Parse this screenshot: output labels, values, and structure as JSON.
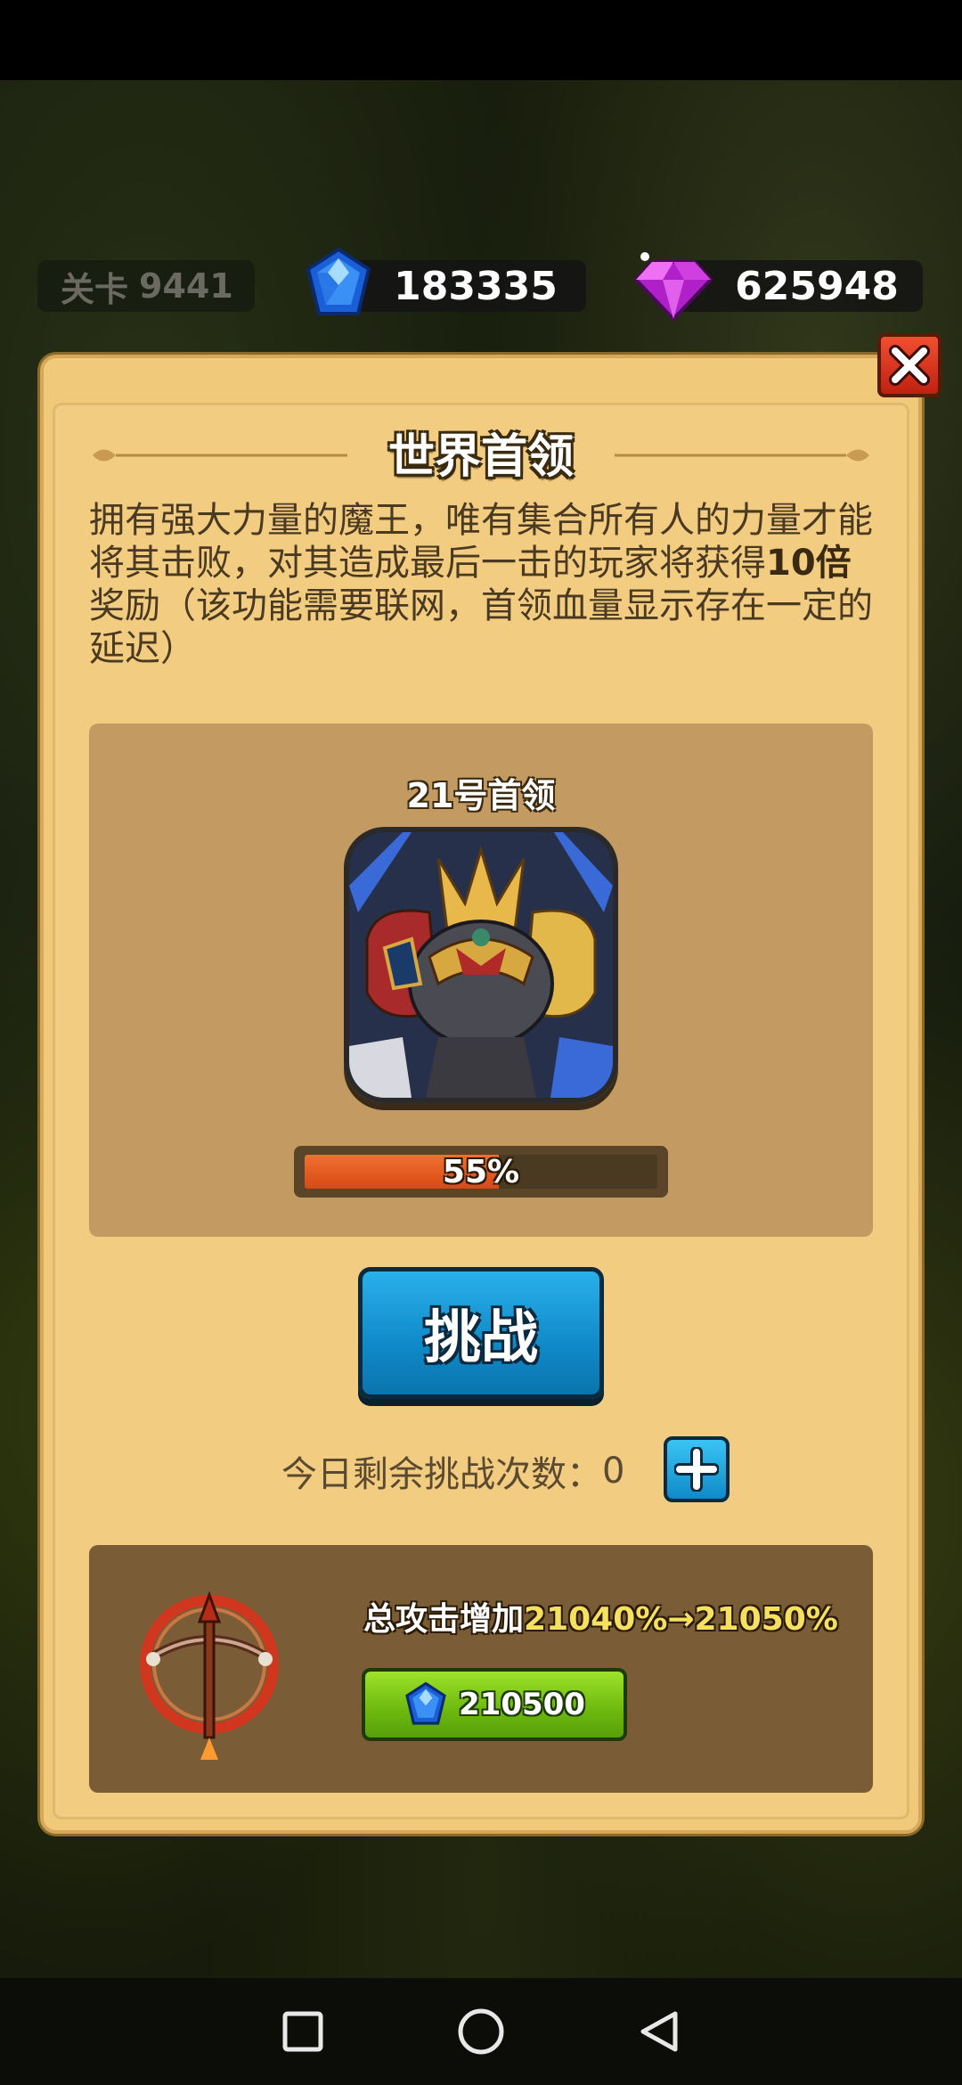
{
  "hud": {
    "level_label": "关卡",
    "level_value": "9441",
    "gems": "183335",
    "diamonds": "625948"
  },
  "modal": {
    "title": "世界首领",
    "description_part1": "拥有强大力量的魔王，唯有集合所有人的力量才能将其击败，对其造成最后一击的玩家将获得",
    "description_highlight": "10倍",
    "description_part2": "奖励（该功能需要联网，首领血量显示存在一定的延迟）",
    "boss_name": "21号首领",
    "boss_hp_percent": 55,
    "boss_hp_text": "55%",
    "challenge_label": "挑战",
    "remaining_label": "今日剩余挑战次数：",
    "remaining_count": "0",
    "upgrade_prefix": "总攻击增加",
    "upgrade_value": "21040%→21050%",
    "buy_cost": "210500"
  },
  "icons": {
    "gem": "blue-gem-icon",
    "diamond": "purple-diamond-icon",
    "close": "close-icon",
    "plus": "plus-icon",
    "weapon": "crossbow-icon"
  },
  "colors": {
    "panel_bg": "#f0ca7a",
    "challenge_blue": "#0f8ac8",
    "buy_green": "#6cb80e",
    "hp_orange": "#e05a1e",
    "close_red": "#d83018"
  }
}
